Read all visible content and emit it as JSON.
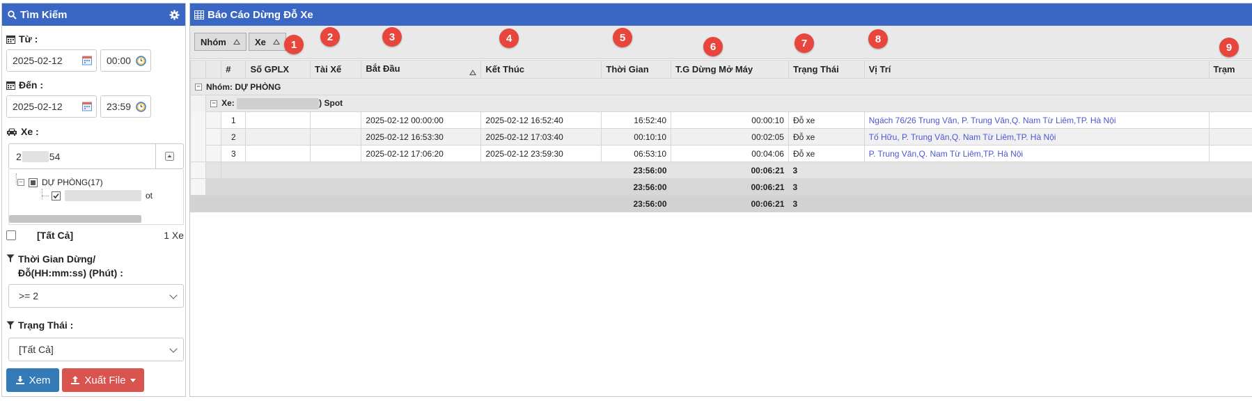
{
  "sidebar": {
    "title": "Tìm Kiếm",
    "from_label": "Từ :",
    "from_date": "2025-02-12",
    "from_time": "00:00",
    "to_label": "Đến :",
    "to_date": "2025-02-12",
    "to_time": "23:59",
    "vehicle_label": "Xe :",
    "vehicle_value_start": "2",
    "vehicle_value_end": "54",
    "tree_group": "DỰ PHÒNG(17)",
    "tree_item_suffix": "ot",
    "all_label": "[Tất Cả]",
    "vehicle_count": "1 Xe",
    "duration_label": "Thời Gian Dừng/ Đỗ(HH:mm:ss) (Phút) :",
    "duration_value": ">= 2",
    "status_label": "Trạng Thái :",
    "status_value": "[Tất Cả]",
    "view_button": "Xem",
    "export_button": "Xuất File"
  },
  "report": {
    "title": "Báo Cáo Dừng Đỗ Xe",
    "group_chips": [
      "Nhóm",
      "Xe"
    ],
    "columns": [
      "#",
      "Số GPLX",
      "Tài Xế",
      "Bắt Đầu",
      "Kết Thúc",
      "Thời Gian",
      "T.G Dừng Mở Máy",
      "Trạng Thái",
      "Vị Trí",
      "Trạm"
    ],
    "group_row": "Nhóm: DỰ PHÒNG",
    "vehicle_row_prefix": "Xe:",
    "vehicle_row_suffix": ") Spot",
    "rows": [
      {
        "no": "1",
        "start": "2025-02-12 00:00:00",
        "end": "2025-02-12 16:52:40",
        "duration": "16:52:40",
        "engine_on": "00:00:10",
        "status": "Đỗ xe",
        "location": "Ngách 76/26 Trung Văn, P. Trung Văn,Q. Nam Từ Liêm,TP. Hà Nội"
      },
      {
        "no": "2",
        "start": "2025-02-12 16:53:30",
        "end": "2025-02-12 17:03:40",
        "duration": "00:10:10",
        "engine_on": "00:02:05",
        "status": "Đỗ xe",
        "location": "Tố Hữu, P. Trung Văn,Q. Nam Từ Liêm,TP. Hà Nội"
      },
      {
        "no": "3",
        "start": "2025-02-12 17:06:20",
        "end": "2025-02-12 23:59:30",
        "duration": "06:53:10",
        "engine_on": "00:04:06",
        "status": "Đỗ xe",
        "location": "P. Trung Văn,Q. Nam Từ Liêm,TP. Hà Nội"
      }
    ],
    "totals": {
      "duration": "23:56:00",
      "engine_on": "00:06:21",
      "count": "3"
    }
  },
  "badges": [
    "1",
    "2",
    "3",
    "4",
    "5",
    "6",
    "7",
    "8",
    "9"
  ],
  "colors": {
    "header_blue": "#3a66c4",
    "view_button": "#337ab7",
    "export_button": "#d9534f",
    "badge": "#e8453c",
    "link": "#4b56d4"
  }
}
